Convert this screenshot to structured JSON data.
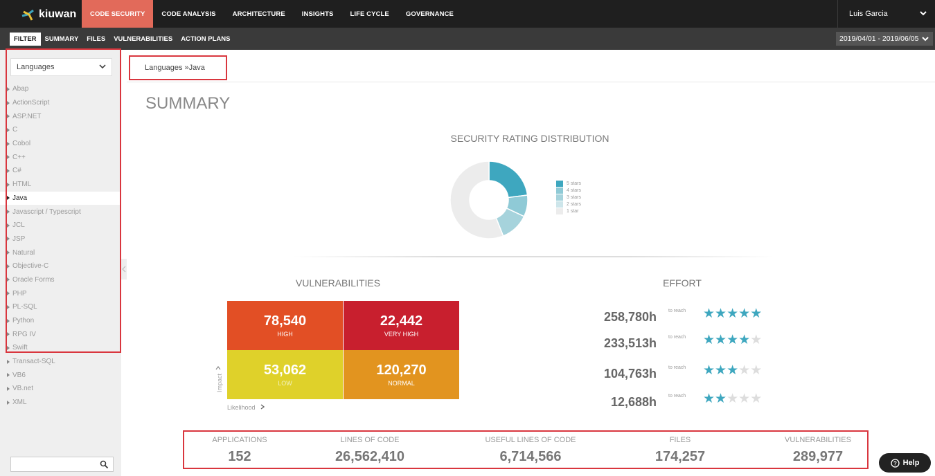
{
  "app": {
    "brand": "kiuwan"
  },
  "topnav": [
    "CODE SECURITY",
    "CODE ANALYSIS",
    "ARCHITECTURE",
    "INSIGHTS",
    "LIFE CYCLE",
    "GOVERNANCE"
  ],
  "user": "Luis Garcia",
  "subnav": [
    "FILTER",
    "SUMMARY",
    "FILES",
    "VULNERABILITIES",
    "ACTION PLANS"
  ],
  "date_range": "2019/04/01 - 2019/06/05",
  "sidebar": {
    "filter_select": "Languages",
    "languages": [
      "Abap",
      "ActionScript",
      "ASP.NET",
      "C",
      "Cobol",
      "C++",
      "C#",
      "HTML",
      "Java",
      "Javascript / Typescript",
      "JCL",
      "JSP",
      "Natural",
      "Objective-C",
      "Oracle Forms",
      "PHP",
      "PL-SQL",
      "Python",
      "RPG IV",
      "Swift",
      "Transact-SQL",
      "VB6",
      "VB.net",
      "XML"
    ],
    "selected": "Java",
    "search_value": ""
  },
  "breadcrumb": "Languages »Java",
  "page_title": "SUMMARY",
  "security_rating": {
    "title": "SECURITY RATING DISTRIBUTION",
    "legend": [
      "5 stars",
      "4 stars",
      "3 stars",
      "2 stars",
      "1 star"
    ],
    "colors": [
      "#3ea7bf",
      "#8fcad6",
      "#a6d3dc",
      "#cde5ea",
      "#ececec"
    ]
  },
  "chart_data": {
    "type": "pie",
    "title": "SECURITY RATING DISTRIBUTION",
    "labels": [
      "5 stars",
      "4 stars",
      "3 stars",
      "2 stars",
      "1 star"
    ],
    "values": [
      23,
      9,
      12,
      0,
      56
    ],
    "donut": true,
    "legend": "right"
  },
  "vulnerabilities": {
    "title": "VULNERABILITIES",
    "cells": [
      {
        "value": "78,540",
        "label": "HIGH",
        "color": "#e24f25"
      },
      {
        "value": "22,442",
        "label": "VERY HIGH",
        "color": "#c81f2e"
      },
      {
        "value": "53,062",
        "label": "LOW",
        "color": "#dfd12a"
      },
      {
        "value": "120,270",
        "label": "NORMAL",
        "color": "#e2941f"
      }
    ],
    "axis_y": "Impact",
    "axis_x": "Likelihood"
  },
  "effort": {
    "title": "EFFORT",
    "reach_label": "to reach",
    "rows": [
      {
        "hours": "258,780h",
        "stars": 5
      },
      {
        "hours": "233,513h",
        "stars": 4
      },
      {
        "hours": "104,763h",
        "stars": 3
      },
      {
        "hours": "12,688h",
        "stars": 2
      }
    ],
    "star_on_color": "#3ea7bf"
  },
  "stats": [
    {
      "label": "APPLICATIONS",
      "value": "152"
    },
    {
      "label": "LINES OF CODE",
      "value": "26,562,410"
    },
    {
      "label": "USEFUL LINES OF CODE",
      "value": "6,714,566"
    },
    {
      "label": "FILES",
      "value": "174,257"
    },
    {
      "label": "VULNERABILITIES",
      "value": "289,977"
    }
  ],
  "help_label": "Help"
}
